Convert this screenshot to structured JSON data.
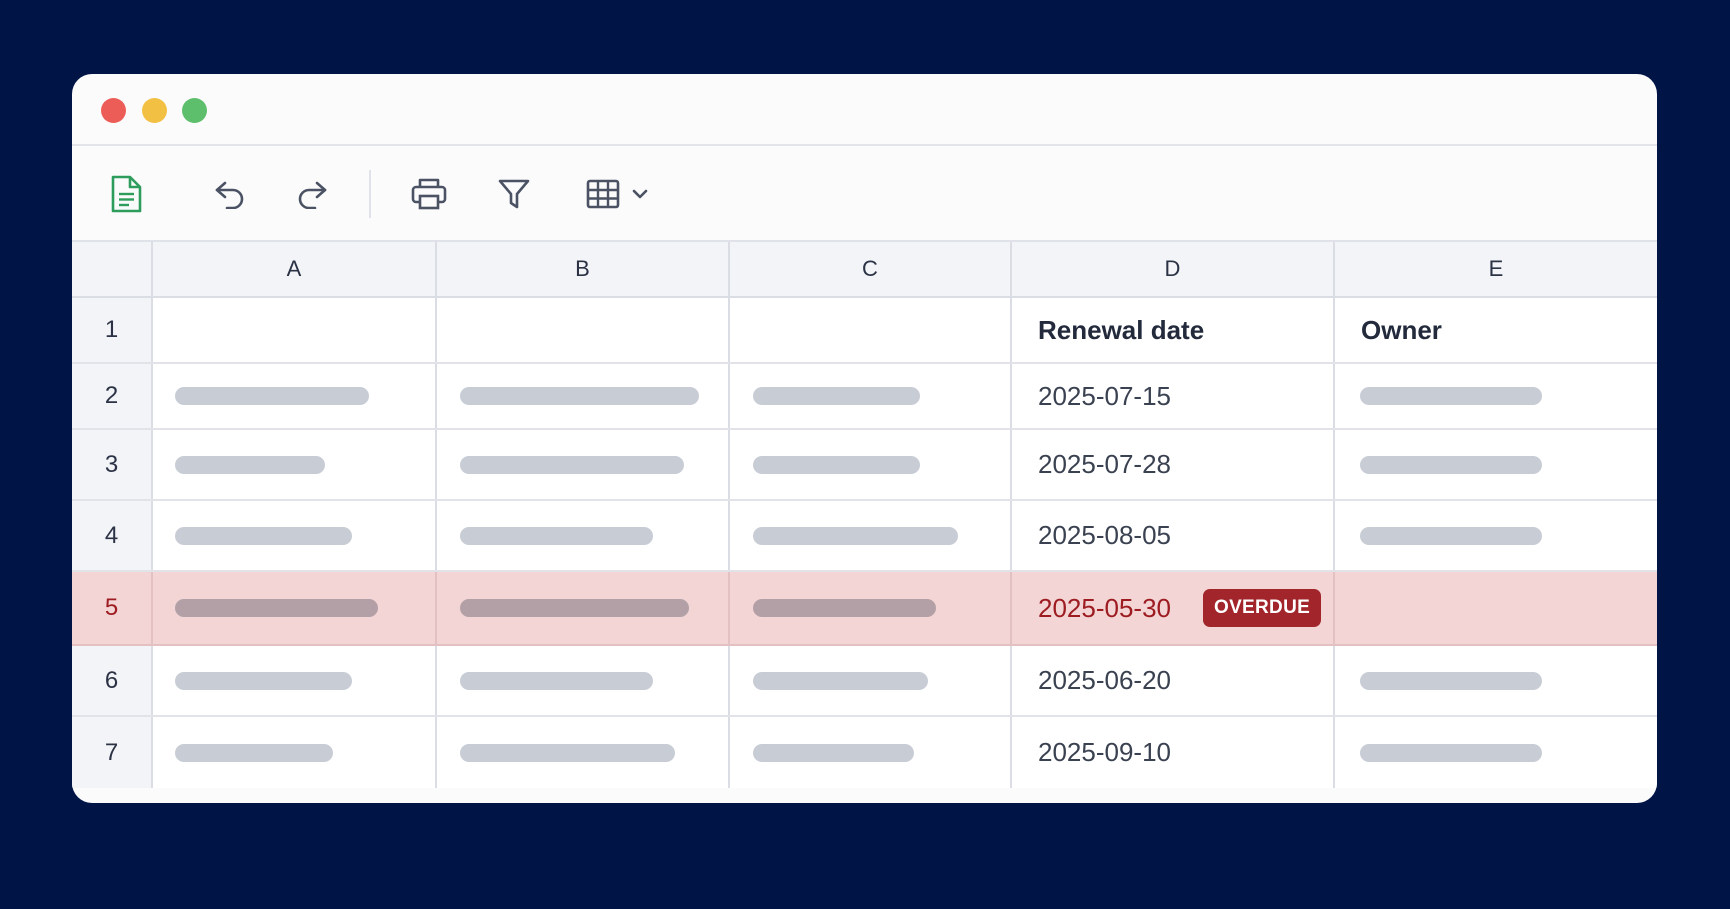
{
  "window": {
    "controls": [
      "close",
      "minimize",
      "maximize"
    ]
  },
  "toolbar": {
    "icons": [
      "spreadsheet-doc-icon",
      "undo-icon",
      "redo-icon",
      "print-icon",
      "filter-icon",
      "table-icon",
      "chevron-down-icon"
    ],
    "accent_color": "#2e9d5c"
  },
  "grid": {
    "columns": [
      "A",
      "B",
      "C",
      "D",
      "E"
    ],
    "row_numbers": [
      "1",
      "2",
      "3",
      "4",
      "5",
      "6",
      "7"
    ],
    "headers": {
      "D": "Renewal date",
      "E": "Owner"
    },
    "rows": [
      {
        "num": "2",
        "date": "2025-07-15"
      },
      {
        "num": "3",
        "date": "2025-07-28"
      },
      {
        "num": "4",
        "date": "2025-08-05"
      },
      {
        "num": "5",
        "date": "2025-05-30",
        "badge": "OVERDUE",
        "highlight": "overdue"
      },
      {
        "num": "6",
        "date": "2025-06-20"
      },
      {
        "num": "7",
        "date": "2025-09-10"
      }
    ],
    "colors": {
      "overdue_row": "#f3d5d6",
      "overdue_text": "#9d1c21",
      "badge_bg": "#a2252b",
      "placeholder_bar": "#c8ccd5"
    }
  }
}
